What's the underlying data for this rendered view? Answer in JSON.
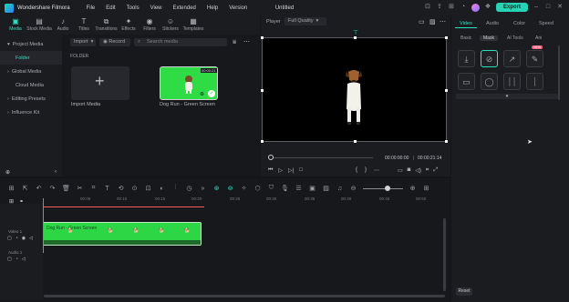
{
  "app": {
    "name": "Wondershare Filmora",
    "doc_title": "Untitled",
    "export_label": "Export",
    "brand_color": "#2ee0c0"
  },
  "menu": [
    "File",
    "Edit",
    "Tools",
    "View",
    "Extended",
    "Help",
    "Version"
  ],
  "toolbar": [
    {
      "label": "Media",
      "icon": "media-icon",
      "active": true
    },
    {
      "label": "Stock Media",
      "icon": "stock-media-icon"
    },
    {
      "label": "Audio",
      "icon": "music-note-icon"
    },
    {
      "label": "Titles",
      "icon": "text-t-icon"
    },
    {
      "label": "Transitions",
      "icon": "transition-icon"
    },
    {
      "label": "Effects",
      "icon": "sparkle-icon"
    },
    {
      "label": "Filters",
      "icon": "filter-icon"
    },
    {
      "label": "Stickers",
      "icon": "sticker-icon"
    },
    {
      "label": "Templates",
      "icon": "template-icon"
    }
  ],
  "sidebar": {
    "items": [
      {
        "label": "Project Media"
      },
      {
        "label": "Folder"
      },
      {
        "label": "Global Media"
      },
      {
        "label": "Cloud Media"
      },
      {
        "label": "Editing Presets"
      },
      {
        "label": "Influence Kit"
      }
    ]
  },
  "media": {
    "import_dropdown": "Import",
    "record_dropdown": "Record",
    "search_placeholder": "Search media",
    "folder_heading": "FOLDER",
    "import_card_label": "Import Media",
    "clip_label": "Dog Run - Green Screen",
    "clip_duration": "00:00:21"
  },
  "player": {
    "label": "Player",
    "quality": "Full Quality",
    "current_time": "00:00:00:00",
    "total_time": "00:00:21:14"
  },
  "properties": {
    "tabs": [
      "Video",
      "Audio",
      "Color",
      "Speed"
    ],
    "subtabs": [
      "Basic",
      "Mask",
      "AI Tools",
      "Ani"
    ],
    "new_badge": "NEW",
    "reset_label": "Reset"
  },
  "timeline": {
    "ruler_ticks": [
      "00:00",
      "00:05",
      "00:10",
      "00:15",
      "00:20",
      "00:25",
      "00:30",
      "00:35",
      "00:40",
      "00:45",
      "00:50"
    ],
    "tracks": [
      {
        "label": "Video 1"
      },
      {
        "label": "Audio 1"
      }
    ],
    "clip_label": "Dog Run - Green Screen"
  }
}
